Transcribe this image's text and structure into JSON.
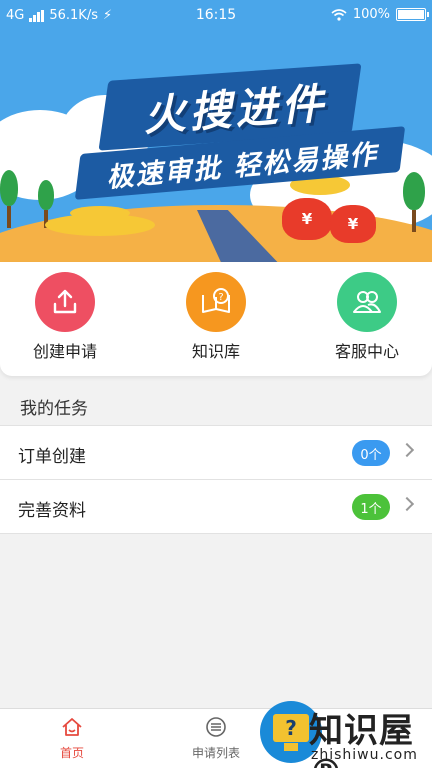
{
  "status_bar": {
    "network": "4G",
    "speed": "56.1K/s",
    "time": "16:15",
    "battery": "100%"
  },
  "banner": {
    "title": "火搜进件",
    "subtitle": "极速审批 轻松易操作",
    "bag_symbol": "¥"
  },
  "quick_actions": [
    {
      "label": "创建申请",
      "icon": "upload-icon",
      "color": "#ee4f62"
    },
    {
      "label": "知识库",
      "icon": "book-question-icon",
      "color": "#f6971f"
    },
    {
      "label": "客服中心",
      "icon": "users-icon",
      "color": "#3dcb86"
    }
  ],
  "tasks": {
    "title": "我的任务",
    "items": [
      {
        "name": "订单创建",
        "badge": "0个",
        "badge_color": "#3a9af0"
      },
      {
        "name": "完善资料",
        "badge": "1个",
        "badge_color": "#4cc23a"
      }
    ]
  },
  "tabbar": {
    "items": [
      {
        "label": "首页",
        "icon": "home-icon",
        "active": true,
        "color": "#e6493e"
      },
      {
        "label": "申请列表",
        "icon": "list-icon",
        "active": false,
        "color": "#666666"
      }
    ]
  },
  "watermark": {
    "brand": "知识屋®",
    "url": "zhishiwu.com",
    "icon_glyph": "?"
  }
}
